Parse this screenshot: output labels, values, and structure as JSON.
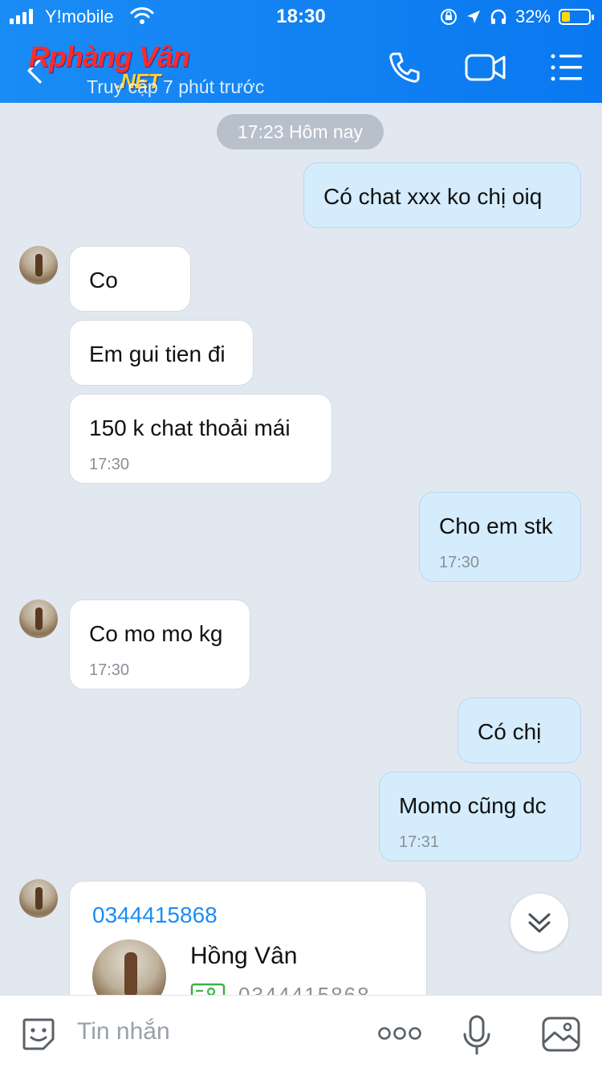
{
  "status_bar": {
    "carrier": "Y!mobile",
    "time": "18:30",
    "battery": "32%",
    "battery_level": 0.32
  },
  "header": {
    "logo_main": "Rphàng Vân",
    "logo_sub": ".NET",
    "subtitle": "Truy cập 7 phút trước"
  },
  "chat": {
    "date_label": "17:23 Hôm nay",
    "messages": [
      {
        "dir": "out",
        "text": "Có chat xxx ko chị oiq",
        "time": ""
      },
      {
        "dir": "in",
        "text": "Co",
        "time": ""
      },
      {
        "dir": "in",
        "text": "Em gui tien đi",
        "time": ""
      },
      {
        "dir": "in",
        "text": "150 k chat thoải mái",
        "time": "17:30"
      },
      {
        "dir": "out",
        "text": "Cho em stk",
        "time": "17:30"
      },
      {
        "dir": "in",
        "text": "Co mo mo kg",
        "time": "17:30"
      },
      {
        "dir": "out",
        "text": "Có chị",
        "time": ""
      },
      {
        "dir": "out",
        "text": "Momo cũng dc",
        "time": "17:31"
      }
    ],
    "contact_card": {
      "phone": "0344415868",
      "name": "Hồng Vân",
      "number": "0344415868"
    }
  },
  "input": {
    "placeholder": "Tin nhắn"
  },
  "icons": {
    "back": "chevron-left-icon",
    "call": "phone-icon",
    "video": "video-camera-icon",
    "menu": "list-menu-icon",
    "scroll": "double-chevron-down-icon",
    "emoji": "sticker-icon",
    "more": "more-dots-icon",
    "mic": "microphone-icon",
    "gallery": "image-icon"
  },
  "colors": {
    "header": "#1a8cf5",
    "chat_bg": "#e2e8f0",
    "bubble_out": "#d4ecfb",
    "bubble_in": "#ffffff",
    "link": "#1a8cf5"
  }
}
